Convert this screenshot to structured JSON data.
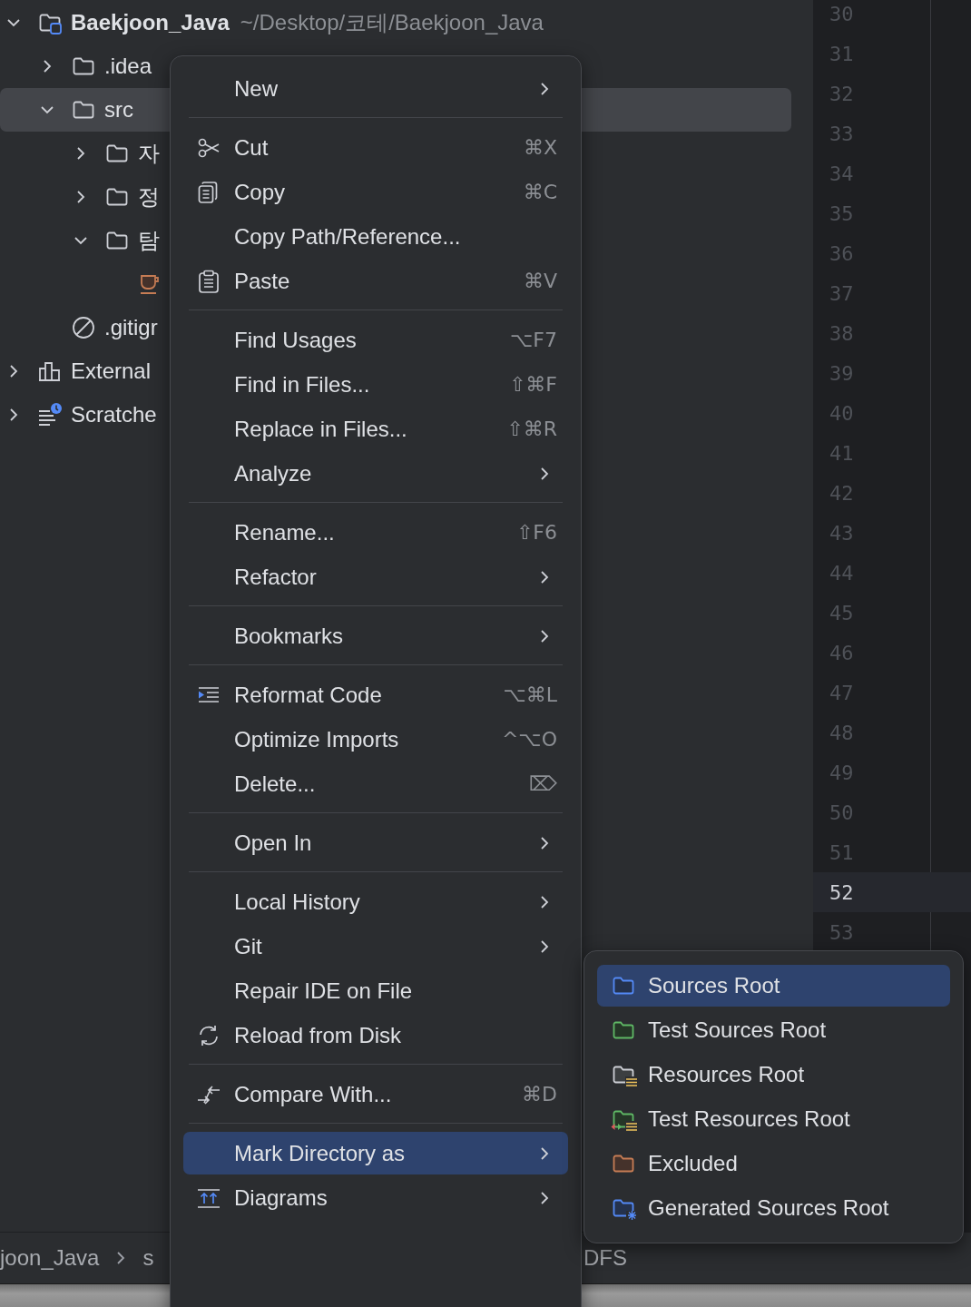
{
  "project_tree": {
    "items": [
      {
        "kind": "project",
        "label": "Baekjoon_Java",
        "detail": "~/Desktop/코테/Baekjoon_Java",
        "expanded": true,
        "selected": false,
        "children": [
          {
            "kind": "folder",
            "label": ".idea",
            "expanded": false,
            "selected": false
          },
          {
            "kind": "folder",
            "label": "src",
            "expanded": true,
            "selected": true,
            "children": [
              {
                "kind": "folder",
                "label": "자",
                "expanded": false,
                "selected": false
              },
              {
                "kind": "folder",
                "label": "정",
                "expanded": false,
                "selected": false
              },
              {
                "kind": "folder",
                "label": "탐",
                "expanded": true,
                "selected": false,
                "children": [
                  {
                    "kind": "java_file",
                    "selected": false
                  }
                ]
              }
            ]
          },
          {
            "kind": "ignore_file",
            "label": ".gitigr",
            "selected": false
          }
        ]
      },
      {
        "kind": "libraries",
        "label": "External",
        "expanded": false,
        "selected": false
      },
      {
        "kind": "scratches",
        "label": "Scratche",
        "expanded": false,
        "selected": false
      }
    ]
  },
  "editor": {
    "line_numbers": [
      {
        "number": "30",
        "current": false
      },
      {
        "number": "31",
        "current": false
      },
      {
        "number": "32",
        "current": false
      },
      {
        "number": "33",
        "current": false
      },
      {
        "number": "34",
        "current": false
      },
      {
        "number": "35",
        "current": false
      },
      {
        "number": "36",
        "current": false
      },
      {
        "number": "37",
        "current": false
      },
      {
        "number": "38",
        "current": false
      },
      {
        "number": "39",
        "current": false
      },
      {
        "number": "40",
        "current": false
      },
      {
        "number": "41",
        "current": false
      },
      {
        "number": "42",
        "current": false
      },
      {
        "number": "43",
        "current": false
      },
      {
        "number": "44",
        "current": false
      },
      {
        "number": "45",
        "current": false
      },
      {
        "number": "46",
        "current": false
      },
      {
        "number": "47",
        "current": false
      },
      {
        "number": "48",
        "current": false
      },
      {
        "number": "49",
        "current": false
      },
      {
        "number": "50",
        "current": false
      },
      {
        "number": "51",
        "current": false
      },
      {
        "number": "52",
        "current": true
      },
      {
        "number": "53",
        "current": false
      }
    ]
  },
  "breadcrumbs": {
    "items": [
      "joon_Java",
      "s"
    ],
    "trailing": "DFS"
  },
  "context_menu": {
    "entries": [
      {
        "kind": "item",
        "label": "New",
        "submenu": true,
        "selected": false
      },
      {
        "kind": "separator"
      },
      {
        "kind": "item",
        "label": "Cut",
        "shortcut": "⌘X",
        "selected": false
      },
      {
        "kind": "item",
        "label": "Copy",
        "shortcut": "⌘C",
        "selected": false
      },
      {
        "kind": "item",
        "label": "Copy Path/Reference...",
        "selected": false
      },
      {
        "kind": "item",
        "label": "Paste",
        "shortcut": "⌘V",
        "selected": false
      },
      {
        "kind": "separator"
      },
      {
        "kind": "item",
        "label": "Find Usages",
        "shortcut": "⌥F7",
        "selected": false
      },
      {
        "kind": "item",
        "label": "Find in Files...",
        "shortcut": "⇧⌘F",
        "selected": false
      },
      {
        "kind": "item",
        "label": "Replace in Files...",
        "shortcut": "⇧⌘R",
        "selected": false
      },
      {
        "kind": "item",
        "label": "Analyze",
        "submenu": true,
        "selected": false
      },
      {
        "kind": "separator"
      },
      {
        "kind": "item",
        "label": "Rename...",
        "shortcut": "⇧F6",
        "selected": false
      },
      {
        "kind": "item",
        "label": "Refactor",
        "submenu": true,
        "selected": false
      },
      {
        "kind": "separator"
      },
      {
        "kind": "item",
        "label": "Bookmarks",
        "submenu": true,
        "selected": false
      },
      {
        "kind": "separator"
      },
      {
        "kind": "item",
        "label": "Reformat Code",
        "shortcut": "⌥⌘L",
        "selected": false
      },
      {
        "kind": "item",
        "label": "Optimize Imports",
        "shortcut": "^⌥O",
        "selected": false
      },
      {
        "kind": "item",
        "label": "Delete...",
        "shortcut": "⌦",
        "selected": false
      },
      {
        "kind": "separator"
      },
      {
        "kind": "item",
        "label": "Open In",
        "submenu": true,
        "selected": false
      },
      {
        "kind": "separator"
      },
      {
        "kind": "item",
        "label": "Local History",
        "submenu": true,
        "selected": false
      },
      {
        "kind": "item",
        "label": "Git",
        "submenu": true,
        "selected": false
      },
      {
        "kind": "item",
        "label": "Repair IDE on File",
        "selected": false
      },
      {
        "kind": "item",
        "label": "Reload from Disk",
        "selected": false
      },
      {
        "kind": "separator"
      },
      {
        "kind": "item",
        "label": "Compare With...",
        "shortcut": "⌘D",
        "selected": false
      },
      {
        "kind": "separator"
      },
      {
        "kind": "item",
        "label": "Mark Directory as",
        "submenu": true,
        "selected": true
      },
      {
        "kind": "item",
        "label": "Diagrams",
        "submenu": true,
        "selected": false
      }
    ]
  },
  "submenu": {
    "items": [
      {
        "label": "Sources Root",
        "selected": true
      },
      {
        "label": "Test Sources Root",
        "selected": false
      },
      {
        "label": "Resources Root",
        "selected": false
      },
      {
        "label": "Test Resources Root",
        "selected": false
      },
      {
        "label": "Excluded",
        "selected": false
      },
      {
        "label": "Generated Sources Root",
        "selected": false
      }
    ]
  }
}
